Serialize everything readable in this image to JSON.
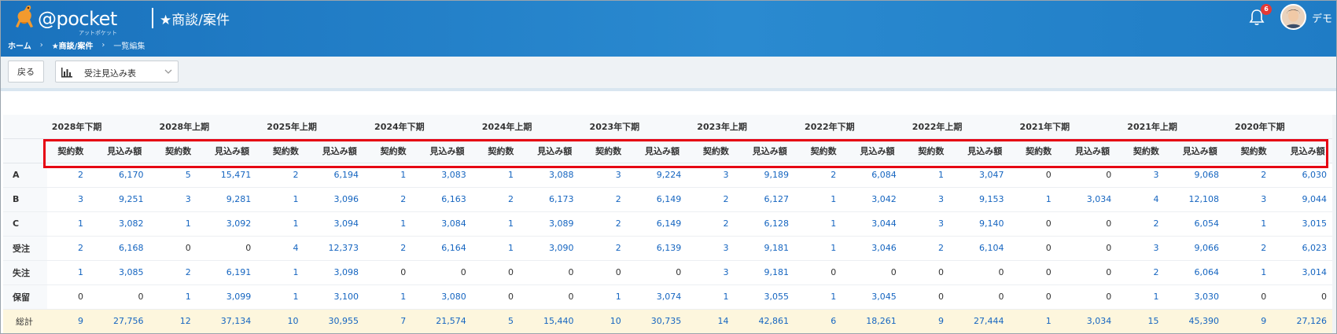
{
  "header": {
    "logo_text": "@pocket",
    "logo_sub": "アットポケット",
    "page_title": "★商談/案件",
    "notification_count": "6",
    "user_name": "デモ",
    "colors": {
      "header_blue": "#1a72bd",
      "badge_red": "#e53935"
    }
  },
  "breadcrumb": [
    "ホーム",
    "★商談/案件",
    "一覧編集"
  ],
  "toolbar": {
    "back_label": "戻る",
    "view_select": "受注見込み表",
    "view_icon": "bar-chart-icon"
  },
  "table": {
    "periods": [
      "2028年下期",
      "2028年上期",
      "2025年上期",
      "2024年下期",
      "2024年上期",
      "2023年下期",
      "2023年上期",
      "2022年下期",
      "2022年上期",
      "2021年下期",
      "2021年上期",
      "2020年下期"
    ],
    "column_headers": [
      "契約数",
      "見込み額"
    ],
    "rows": [
      {
        "label": "A",
        "cells": [
          "2",
          "6,170",
          "5",
          "15,471",
          "2",
          "6,194",
          "1",
          "3,083",
          "1",
          "3,088",
          "3",
          "9,224",
          "3",
          "9,189",
          "2",
          "6,084",
          "1",
          "3,047",
          "0",
          "0",
          "3",
          "9,068",
          "2",
          "6,030"
        ]
      },
      {
        "label": "B",
        "cells": [
          "3",
          "9,251",
          "3",
          "9,281",
          "1",
          "3,096",
          "2",
          "6,163",
          "2",
          "6,173",
          "2",
          "6,149",
          "2",
          "6,127",
          "1",
          "3,042",
          "3",
          "9,153",
          "1",
          "3,034",
          "4",
          "12,108",
          "3",
          "9,044"
        ]
      },
      {
        "label": "C",
        "cells": [
          "1",
          "3,082",
          "1",
          "3,092",
          "1",
          "3,094",
          "1",
          "3,084",
          "1",
          "3,089",
          "2",
          "6,149",
          "2",
          "6,128",
          "1",
          "3,044",
          "3",
          "9,140",
          "0",
          "0",
          "2",
          "6,054",
          "1",
          "3,015"
        ]
      },
      {
        "label": "受注",
        "cells": [
          "2",
          "6,168",
          "0",
          "0",
          "4",
          "12,373",
          "2",
          "6,164",
          "1",
          "3,090",
          "2",
          "6,139",
          "3",
          "9,181",
          "1",
          "3,046",
          "2",
          "6,104",
          "0",
          "0",
          "3",
          "9,066",
          "2",
          "6,023"
        ]
      },
      {
        "label": "失注",
        "cells": [
          "1",
          "3,085",
          "2",
          "6,191",
          "1",
          "3,098",
          "0",
          "0",
          "0",
          "0",
          "0",
          "0",
          "3",
          "9,181",
          "0",
          "0",
          "0",
          "0",
          "0",
          "0",
          "2",
          "6,064",
          "1",
          "3,014"
        ]
      },
      {
        "label": "保留",
        "cells": [
          "0",
          "0",
          "1",
          "3,099",
          "1",
          "3,100",
          "1",
          "3,080",
          "0",
          "0",
          "1",
          "3,074",
          "1",
          "3,055",
          "1",
          "3,045",
          "0",
          "0",
          "0",
          "0",
          "1",
          "3,030",
          "0",
          "0"
        ]
      },
      {
        "label": "総計",
        "cells": [
          "9",
          "27,756",
          "12",
          "37,134",
          "10",
          "30,955",
          "7",
          "21,574",
          "5",
          "15,440",
          "10",
          "30,735",
          "14",
          "42,861",
          "6",
          "18,261",
          "9",
          "27,444",
          "1",
          "3,034",
          "15",
          "45,390",
          "9",
          "27,126"
        ]
      }
    ]
  }
}
